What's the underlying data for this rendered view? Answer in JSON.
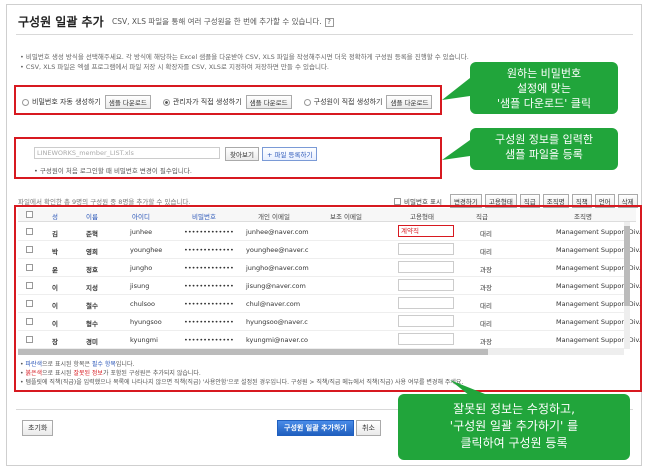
{
  "header": {
    "title": "구성원 일괄 추가",
    "description": "CSV, XLS 파일을 통해 여러 구성원을 한 번에 추가할 수 있습니다.",
    "help": "?"
  },
  "notes": [
    "• 비밀번호 생성 방식을 선택해주세요. 각 방식에 해당하는 Excel 샘플을 다운받아 CSV, XLS 파일을 작성해주시면 더욱 정확하게 구성원 등록을 진행할 수 있습니다.",
    "• CSV, XLS 파일은 엑셀 프로그램에서 파일 저장 시 확장자를 CSV, XLS로 지정하여 저장하면 만들 수 있습니다."
  ],
  "password_options": [
    {
      "label": "비밀번호 자동 생성하기",
      "button": "샘플 다운로드",
      "selected": false
    },
    {
      "label": "관리자가 직접 생성하기",
      "button": "샘플 다운로드",
      "selected": true
    },
    {
      "label": "구성원이 직접 생성하기",
      "button": "샘플 다운로드",
      "selected": false
    }
  ],
  "upload": {
    "file_placeholder": "LINEWORKS_member_LIST.xls",
    "browse_label": "찾아보기",
    "register_label": "+ 파일 등록하기",
    "note": "• 구성원이 처음 로그인할 때 비밀번호 변경이 필수입니다."
  },
  "info_line": "파일에서 확인한 총 9명의 구성원 중 8명을 추가할 수 있습니다.",
  "toolbar": {
    "show_password": "비밀번호 표시",
    "buttons": [
      "변경하기",
      "고용형태",
      "직급",
      "조직명",
      "직책",
      "언어",
      "삭제"
    ]
  },
  "columns": [
    "성",
    "이름",
    "아이디",
    "비밀번호",
    "개인 이메일",
    "보조 이메일",
    "고용형태",
    "직급",
    "조직명"
  ],
  "rows": [
    {
      "last": "김",
      "first": "준혁",
      "id": "junhee",
      "pw": "•••••••••••••",
      "email": "junhee@naver.com",
      "type": "계약직",
      "rank": "대리",
      "org": "Management Support Div.",
      "err": true
    },
    {
      "last": "박",
      "first": "영희",
      "id": "younghee",
      "pw": "•••••••••••••",
      "email": "younghee@naver.c",
      "type": "",
      "rank": "대리",
      "org": "Management Support Div.",
      "err": false
    },
    {
      "last": "윤",
      "first": "정호",
      "id": "jungho",
      "pw": "•••••••••••••",
      "email": "jungho@naver.com",
      "type": "",
      "rank": "과장",
      "org": "Management Support Div.",
      "err": false
    },
    {
      "last": "이",
      "first": "지성",
      "id": "jisung",
      "pw": "•••••••••••••",
      "email": "jisung@naver.com",
      "type": "",
      "rank": "과장",
      "org": "Management Support Div.",
      "err": false
    },
    {
      "last": "이",
      "first": "철수",
      "id": "chulsoo",
      "pw": "•••••••••••••",
      "email": "chul@naver.com",
      "type": "",
      "rank": "대리",
      "org": "Management Support Div.",
      "err": false
    },
    {
      "last": "이",
      "first": "형수",
      "id": "hyungsoo",
      "pw": "•••••••••••••",
      "email": "hyungsoo@naver.c",
      "type": "",
      "rank": "대리",
      "org": "Management Support Div.",
      "err": false
    },
    {
      "last": "장",
      "first": "경미",
      "id": "kyungmi",
      "pw": "•••••••••••••",
      "email": "kyungmi@naver.co",
      "type": "",
      "rank": "과장",
      "org": "Management Support Div.",
      "err": false
    }
  ],
  "footer_notes": {
    "blue_label": "파란색",
    "line1_a": "으로 표시된 항목은 ",
    "line1_b": "필수 항목",
    "line1_c": "입니다.",
    "red_label": "붉은색",
    "line2_a": "으로 표시된 ",
    "line2_b": "잘못된 정보",
    "line2_c": "가 포함된 구성원은 추가되지 않습니다.",
    "line3": "• 템플릿에 직책(직급)을 입력했으나 목록에 나타나지 않으면 직책(직급) '사용안함'으로 설정된 경우입니다. 구성원 > 직책/직급 메뉴에서 직책(직급) 사용 여부를 변경해 주세요."
  },
  "actions": {
    "reset": "초기화",
    "submit": "구성원 일괄 추가하기",
    "cancel": "취소"
  },
  "callouts": {
    "c1": [
      "원하는 비밀번호",
      "설정에 맞는",
      "'샘플 다운로드' 클릭"
    ],
    "c2": [
      "구성원 정보를 입력한",
      "샘플 파일을 등록"
    ],
    "c3": [
      "잘못된 정보는 수정하고,",
      "'구성원 일괄 추가하기' 를",
      "클릭하여 구성원 등록"
    ]
  },
  "colors": {
    "accent_red": "#d71920",
    "callout_green": "#21a53b",
    "link_blue": "#2a56b8"
  }
}
